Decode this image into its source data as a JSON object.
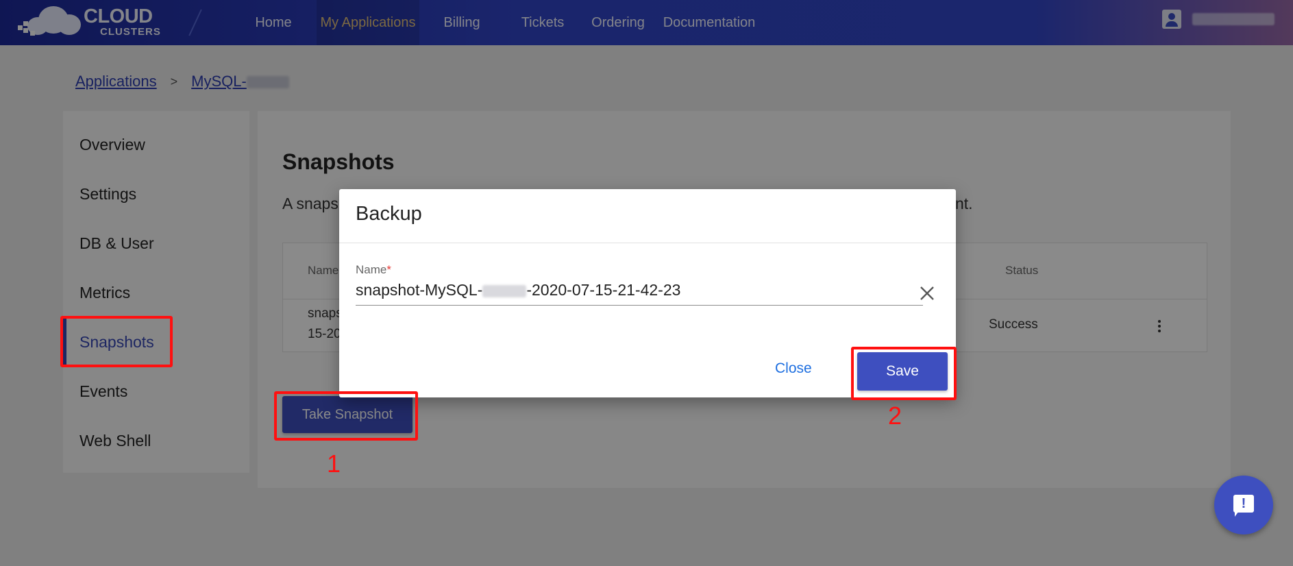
{
  "brand": {
    "line1": "CLOUD",
    "line2": "CLUSTERS"
  },
  "nav": {
    "items": [
      {
        "label": "Home"
      },
      {
        "label": "My Applications",
        "active": true
      },
      {
        "label": "Billing"
      },
      {
        "label": "Tickets"
      },
      {
        "label": "Ordering"
      },
      {
        "label": "Documentation"
      }
    ]
  },
  "breadcrumb": {
    "root": "Applications",
    "separator": ">",
    "current": "MySQL-"
  },
  "sidebar": {
    "items": [
      {
        "label": "Overview"
      },
      {
        "label": "Settings"
      },
      {
        "label": "DB & User"
      },
      {
        "label": "Metrics"
      },
      {
        "label": "Snapshots",
        "active": true
      },
      {
        "label": "Events"
      },
      {
        "label": "Web Shell"
      }
    ]
  },
  "main": {
    "title": "Snapshots",
    "desc_left": "A snaps",
    "desc_right": "nt.",
    "table": {
      "headers": {
        "name": "Name",
        "status": "Status"
      },
      "row": {
        "name_line1": "snaps",
        "name_line2": "15-20",
        "status": "Success"
      }
    },
    "take_snapshot": "Take Snapshot"
  },
  "dialog": {
    "title": "Backup",
    "field_label": "Name",
    "required_mark": "*",
    "value_prefix": "snapshot-MySQL-",
    "value_suffix": "-2020-07-15-21-42-23",
    "close": "Close",
    "save": "Save"
  },
  "annotations": {
    "n1": "1",
    "n2": "2"
  },
  "colors": {
    "accent": "#3e4fbf",
    "annotation": "#ff1010",
    "nav_active": "#e5c27a"
  }
}
